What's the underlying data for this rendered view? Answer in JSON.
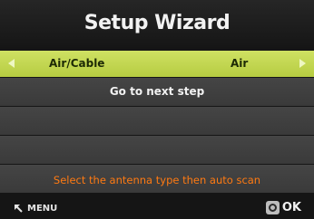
{
  "window": {
    "title": "Setup Wizard"
  },
  "menu": {
    "rows": [
      {
        "label": "Air/Cable",
        "value": "Air",
        "selected": true
      },
      {
        "label": "Go to next step"
      }
    ]
  },
  "hint": {
    "text": "Select the antenna type then auto scan"
  },
  "footer": {
    "menu_label": "MENU",
    "ok_label": "OK"
  },
  "colors": {
    "selection_highlight": "#c3d84f",
    "hint_text": "#ff7a12",
    "background": "#151515",
    "row_background": "#404040"
  },
  "icons": {
    "left_arrow": "left-arrow-icon",
    "right_arrow": "right-arrow-icon",
    "menu_back": "return-arrow-icon",
    "ok_button": "ok-circle-icon"
  }
}
